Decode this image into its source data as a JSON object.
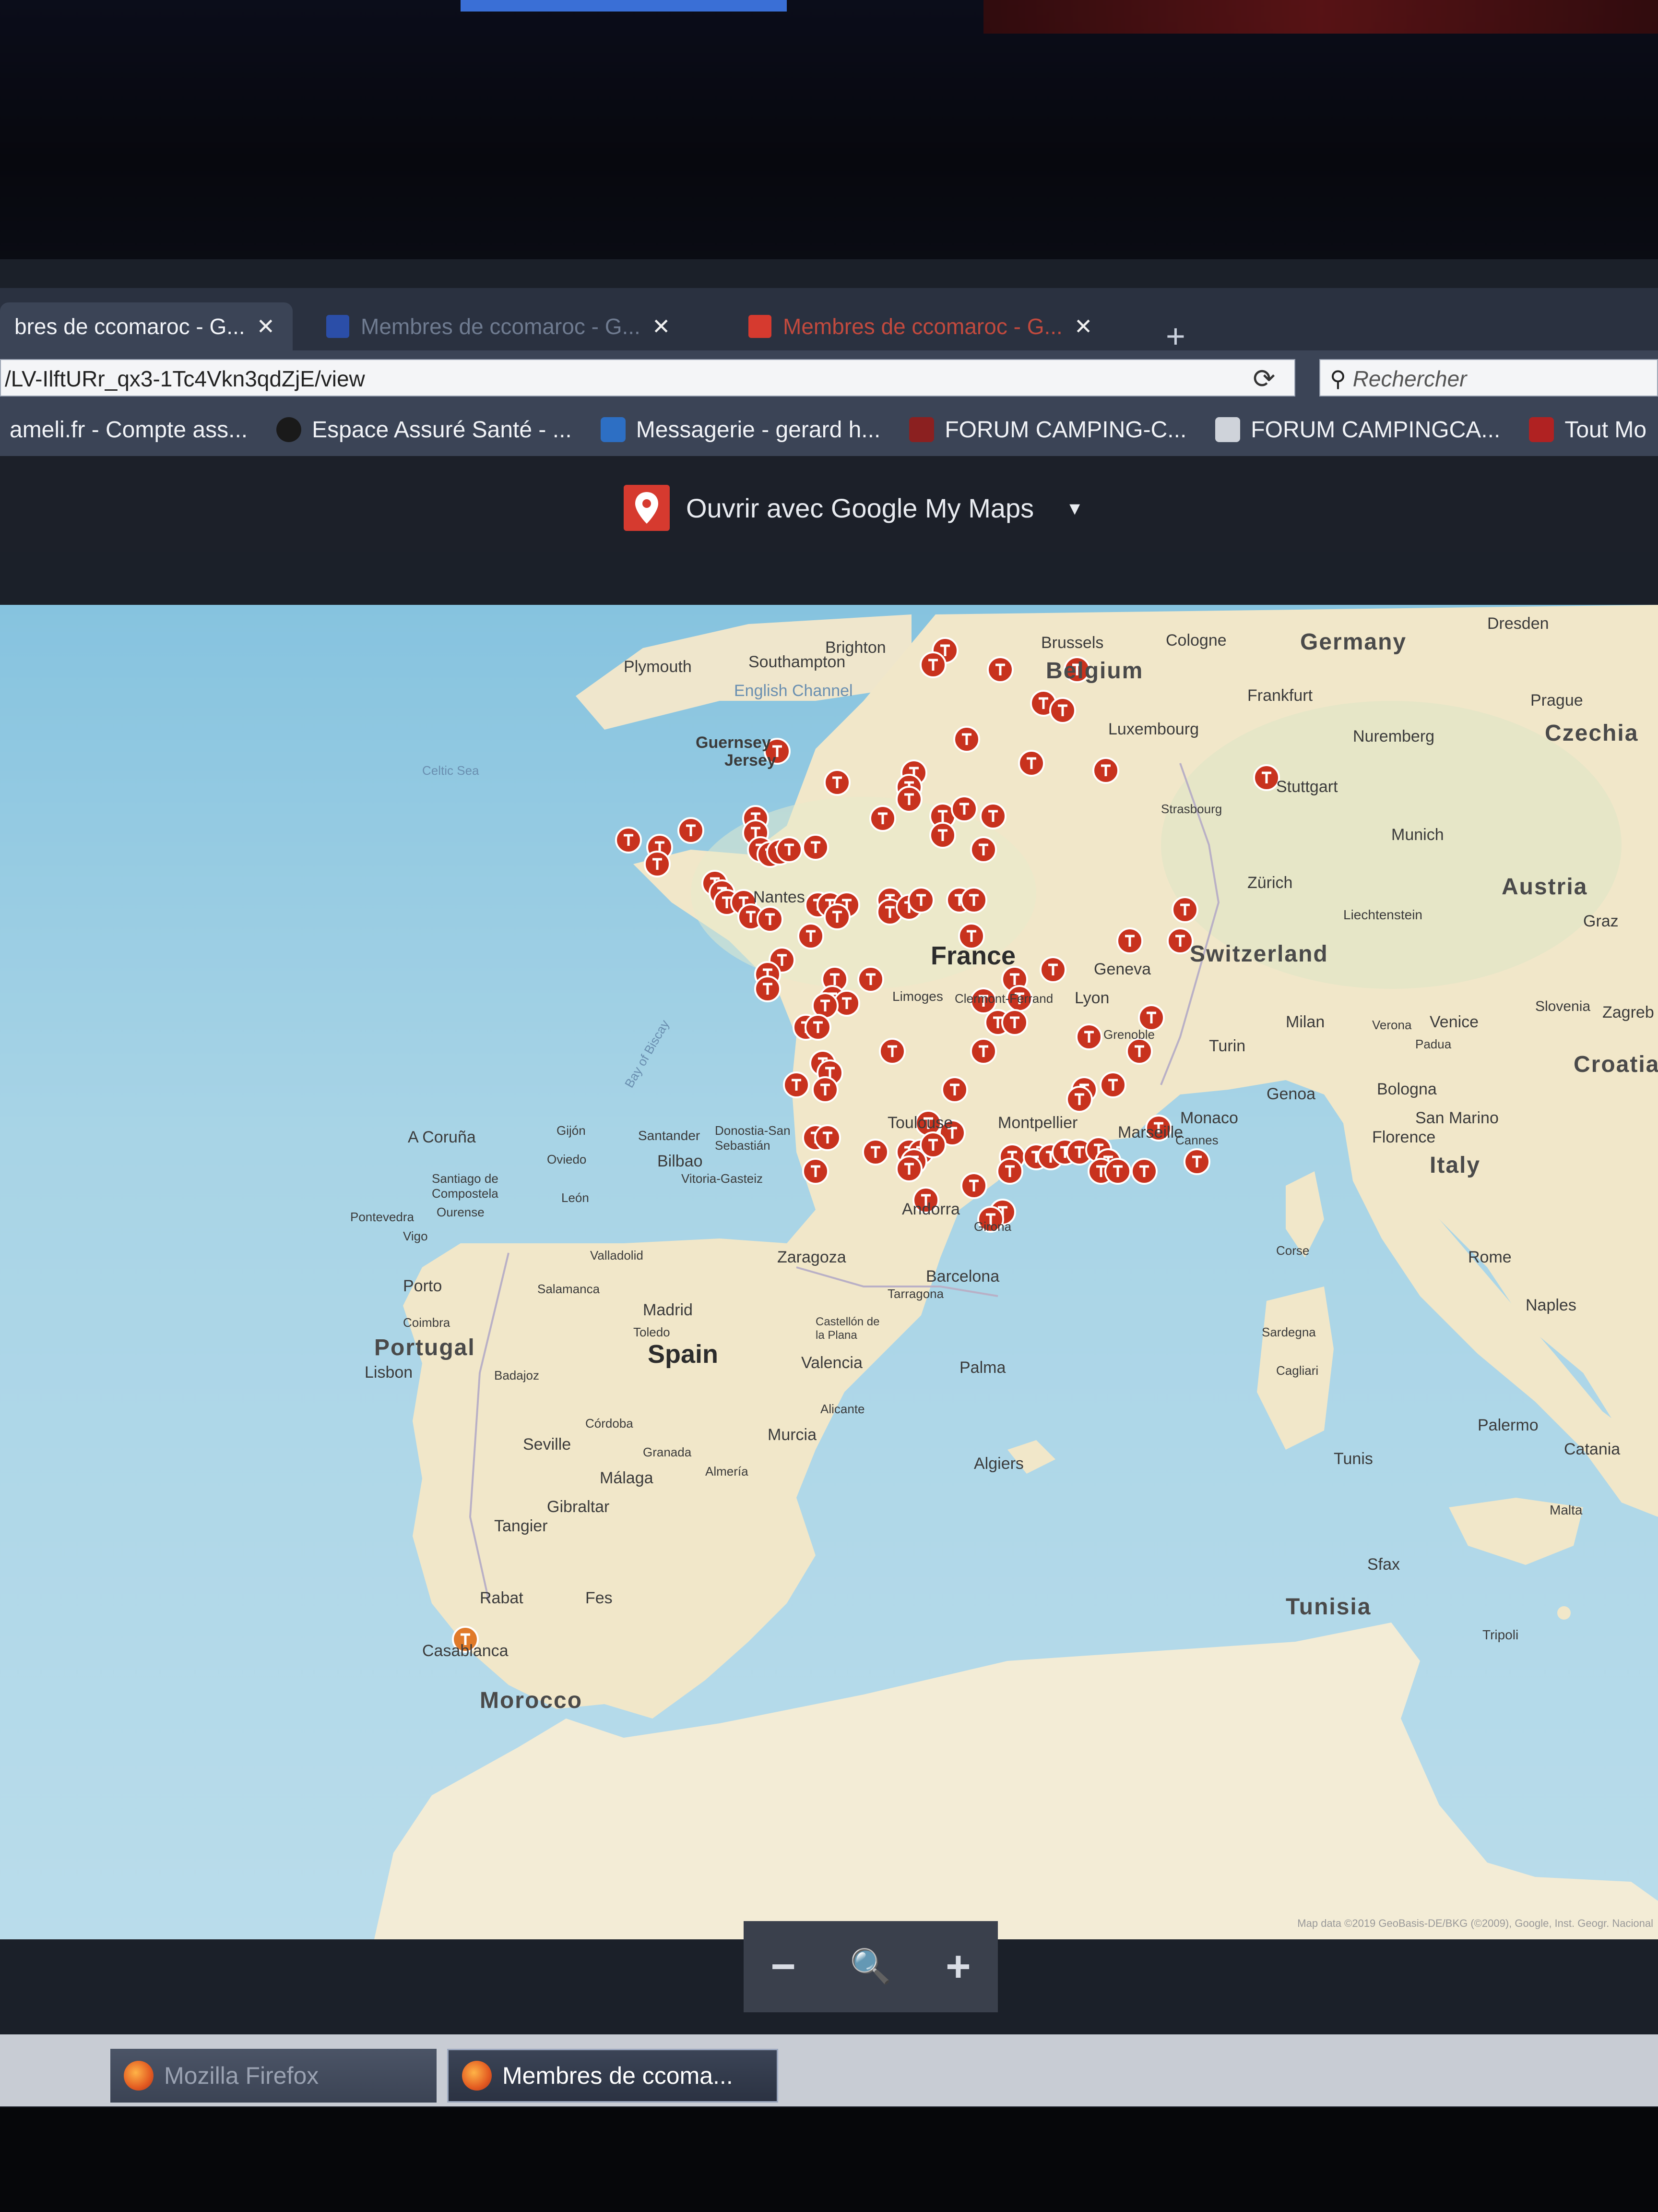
{
  "browser": {
    "tabs": [
      {
        "label": "bres de ccomaroc - G...",
        "close": "✕"
      },
      {
        "label": "Membres de ccomaroc - G...",
        "close": "✕"
      },
      {
        "label": "Membres de ccomaroc - G...",
        "close": "✕"
      }
    ],
    "new_tab": "+",
    "url": "/LV-IlftURr_qx3-1Tc4Vkn3qdZjE/view",
    "reload": "⟳",
    "search_placeholder": "Rechercher"
  },
  "bookmarks": [
    {
      "label": "ameli.fr - Compte ass..."
    },
    {
      "label": "Espace Assuré Santé - ..."
    },
    {
      "label": "Messagerie - gerard h..."
    },
    {
      "label": "FORUM CAMPING-C..."
    },
    {
      "label": "FORUM CAMPINGCA..."
    },
    {
      "label": "Tout Mo"
    }
  ],
  "viewer": {
    "open_button": "Ouvrir avec Google My Maps",
    "caret": "▾"
  },
  "map": {
    "countries": {
      "germany": "Germany",
      "belgium": "Belgium",
      "czechia": "Czechia",
      "austria": "Austria",
      "switzerland": "Switzerland",
      "france": "France",
      "croatia": "Croatia",
      "italy": "Italy",
      "portugal": "Portugal",
      "spain": "Spain",
      "tunisia": "Tunisia",
      "morocco": "Morocco"
    },
    "cities": {
      "plymouth": "Plymouth",
      "southampton": "Southampton",
      "brighton": "Brighton",
      "brussels": "Brussels",
      "cologne": "Cologne",
      "dresden": "Dresden",
      "frankfurt": "Frankfurt",
      "prague": "Prague",
      "luxembourg": "Luxembourg",
      "nuremberg": "Nuremberg",
      "guernsey": "Guernsey",
      "jersey": "Jersey",
      "stuttgart": "Stuttgart",
      "strasbourg": "Strasbourg",
      "munich": "Munich",
      "zurich": "Zürich",
      "liechtenstein": "Liechtenstein",
      "graz": "Graz",
      "nantes": "Nantes",
      "geneva": "Geneva",
      "limoges": "Limoges",
      "clermont": "Clermont-Ferrand",
      "lyon": "Lyon",
      "milan": "Milan",
      "venice": "Venice",
      "verona": "Verona",
      "padua": "Padua",
      "slovenia": "Slovenia",
      "zagreb": "Zagreb",
      "turin": "Turin",
      "grenoble": "Grenoble",
      "genoa": "Genoa",
      "bologna": "Bologna",
      "bay_of_biscay": "Bay of Biscay",
      "toulouse": "Toulouse",
      "montpellier": "Montpellier",
      "marseille": "Marseille",
      "monaco": "Monaco",
      "cannes": "Cannes",
      "san_marino": "San Marino",
      "florence": "Florence",
      "a_coruna": "A Coruña",
      "gijon": "Gijón",
      "santander": "Santander",
      "donostia": "Donostia-San Sebastián",
      "bilbao": "Bilbao",
      "oviedo": "Oviedo",
      "vitoria": "Vitoria-Gasteiz",
      "santiago": "Santiago de Compostela",
      "ourense": "Ourense",
      "pontevedra": "Pontevedra",
      "vigo": "Vigo",
      "leon": "León",
      "andorra": "Andorra",
      "girona": "Girona",
      "valladolid": "Valladolid",
      "zaragoza": "Zaragoza",
      "barcelona": "Barcelona",
      "tarragona": "Tarragona",
      "corse": "Corse",
      "rome": "Rome",
      "porto": "Porto",
      "salamanca": "Salamanca",
      "madrid": "Madrid",
      "toledo": "Toledo",
      "coimbra": "Coimbra",
      "castellon": "Castellón de la Plana",
      "valencia": "Valencia",
      "palma": "Palma",
      "sardegna": "Sardegna",
      "cagliari": "Cagliari",
      "naples": "Naples",
      "lisbon": "Lisbon",
      "badajoz": "Badajoz",
      "cordoba": "Córdoba",
      "alicante": "Alicante",
      "murcia": "Murcia",
      "seville": "Seville",
      "granada": "Granada",
      "almeria": "Almería",
      "malaga": "Málaga",
      "palermo": "Palermo",
      "catania": "Catania",
      "algiers": "Algiers",
      "tunis": "Tunis",
      "malta": "Malta",
      "gibraltar": "Gibraltar",
      "tangier": "Tangier",
      "sfax": "Sfax",
      "rabat": "Rabat",
      "fes": "Fes",
      "casablanca": "Casablanca",
      "tripoli": "Tripoli",
      "celtic_sea": "Celtic Sea",
      "english_channel": "English Channel"
    },
    "attribution": "Map data ©2019 GeoBasis-DE/BKG (©2009), Google, Inst. Geogr. Nacional",
    "marker_color": "#c8321e",
    "marker_icon": "map-marker-icon"
  },
  "zoom": {
    "minus": "−",
    "reset": "🔍",
    "plus": "+"
  },
  "taskbar": {
    "items": [
      {
        "label": "Mozilla Firefox"
      },
      {
        "label": "Membres de ccoma..."
      }
    ]
  }
}
